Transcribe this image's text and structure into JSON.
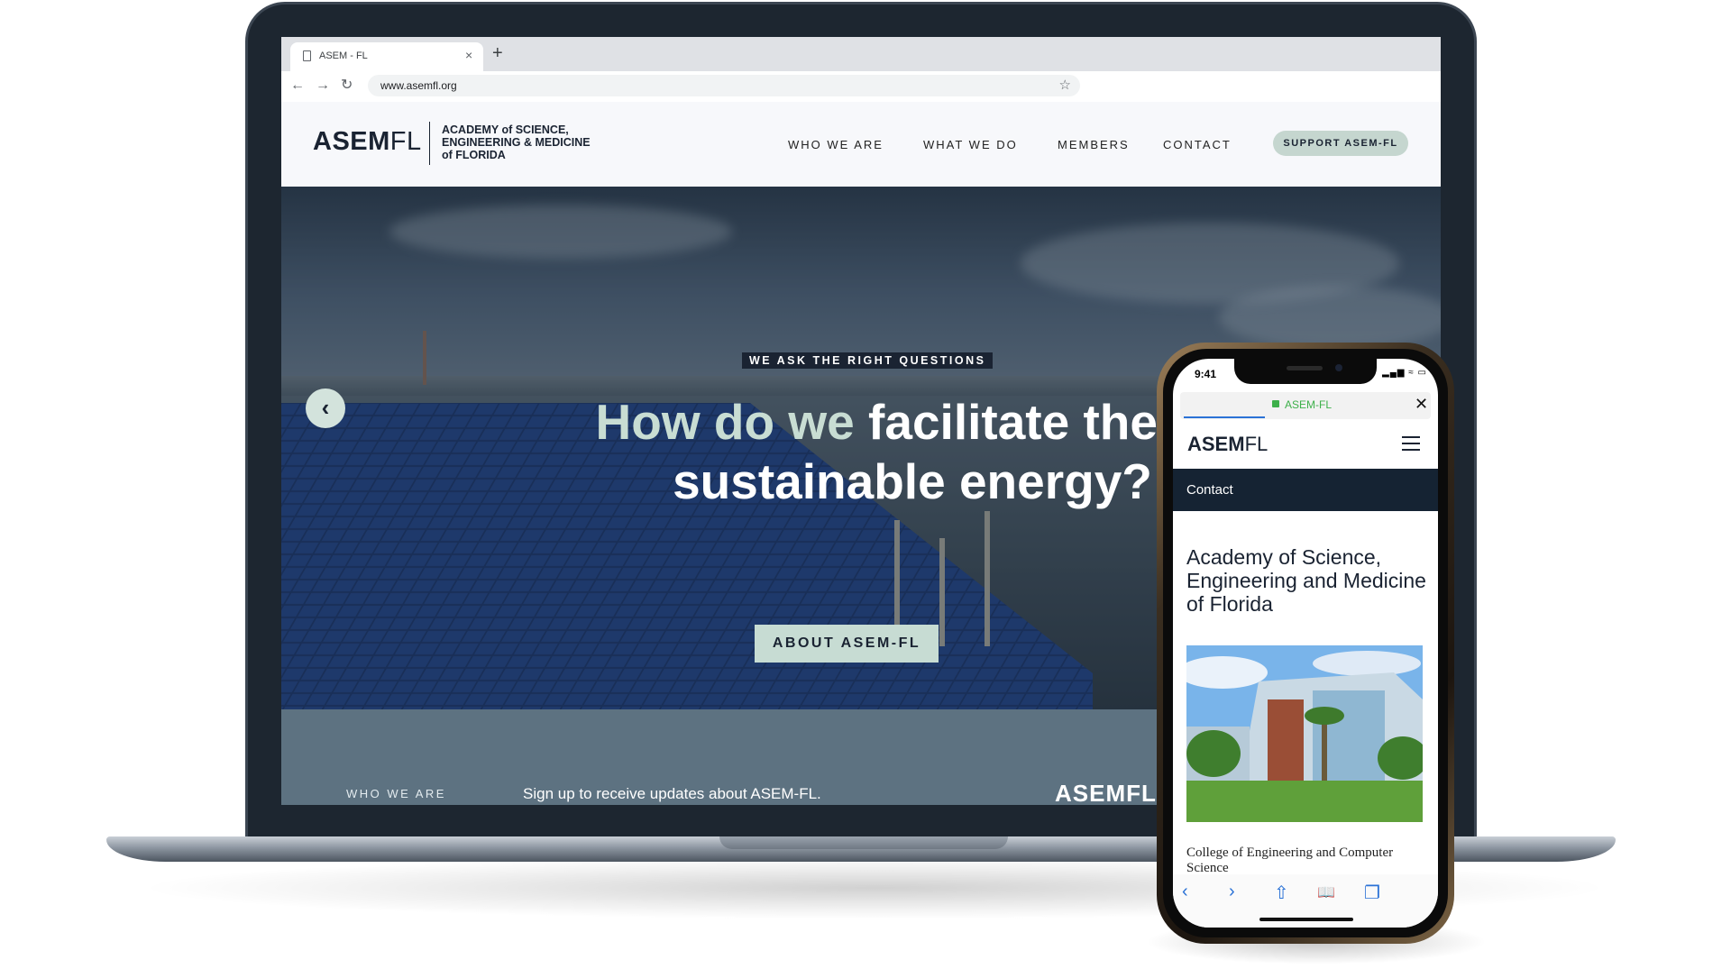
{
  "browser": {
    "tab_title": "ASEM - FL",
    "tab_close": "×",
    "new_tab": "+",
    "back": "←",
    "forward": "→",
    "reload": "↻",
    "url": "www.asemfl.org",
    "bookmark": "☆"
  },
  "site": {
    "logo_bold": "ASEM",
    "logo_light": "FL",
    "logo_sub_line1": "ACADEMY of SCIENCE,",
    "logo_sub_line2": "ENGINEERING & MEDICINE",
    "logo_sub_line3": "of FLORIDA",
    "nav": [
      "WHO WE ARE",
      "WHAT WE DO",
      "MEMBERS",
      "CONTACT"
    ],
    "support_label": "SUPPORT ASEM-FL"
  },
  "hero": {
    "kicker": "WE ASK THE RIGHT QUESTIONS",
    "headline_soft": "How do we ",
    "headline_strong": "facilitate the us",
    "headline_line2": "sustainable energy?",
    "prev_arrow": "‹",
    "button_label": "ABOUT ASEM-FL"
  },
  "footer": {
    "who": "WHO WE ARE",
    "signup": "Sign up to receive updates about ASEM-FL.",
    "logo": "ASEMFL"
  },
  "phone": {
    "time": "9:41",
    "status": "▂▄▆ ≈ ▭",
    "address": "ASEM-FL",
    "close": "✕",
    "logo_bold": "ASEM",
    "logo_light": "FL",
    "menu_item": "Contact",
    "title": "Academy of Science, Engineering and Medicine of Florida",
    "caption": "College of Engineering and Computer Science",
    "toolbar": {
      "back": "‹",
      "forward": "›",
      "share": "⇧",
      "bookmarks": "📖",
      "tabs": "❐"
    }
  },
  "colors": {
    "navy": "#1a2332",
    "mint": "#c7dcd3",
    "slate": "#5d7281",
    "link_blue": "#2b72d6",
    "lock_green": "#3db04a"
  }
}
